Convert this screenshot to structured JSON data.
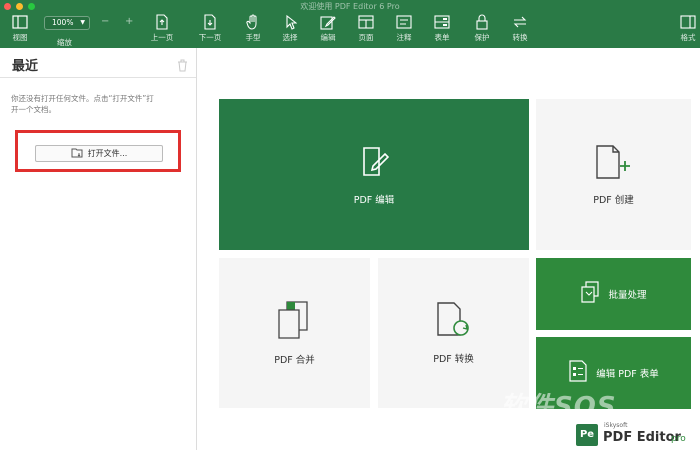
{
  "window": {
    "title": "欢迎使用 PDF Editor 6 Pro"
  },
  "toolbar": {
    "view_label": "视图",
    "zoom_value": "100%",
    "zoom_label": "缩放",
    "zoom_minus": "−",
    "zoom_plus": "+",
    "items": [
      {
        "label": "上一页",
        "icon": "prev-page-icon"
      },
      {
        "label": "下一页",
        "icon": "next-page-icon"
      },
      {
        "label": "手型",
        "icon": "hand-icon"
      },
      {
        "label": "选择",
        "icon": "select-arrow-icon"
      },
      {
        "label": "编辑",
        "icon": "edit-icon"
      },
      {
        "label": "页面",
        "icon": "page-icon"
      },
      {
        "label": "注释",
        "icon": "comment-icon"
      },
      {
        "label": "表单",
        "icon": "form-icon"
      },
      {
        "label": "保护",
        "icon": "lock-icon"
      },
      {
        "label": "转换",
        "icon": "convert-icon"
      }
    ],
    "format_label": "格式"
  },
  "sidebar": {
    "title": "最近",
    "hint": "你还没有打开任何文件。点击“打开文件”打开一个文档。",
    "open_button": "打开文件..."
  },
  "tiles": {
    "edit": "PDF 编辑",
    "create": "PDF 创建",
    "combine": "PDF 合并",
    "convert": "PDF 转换",
    "batch": "批量处理",
    "form": "编辑 PDF 表单"
  },
  "branding": {
    "watermark": "软件SOS",
    "logo": "Pe",
    "company": "iSkysoft",
    "product": "PDF Editor",
    "edition": "pro"
  },
  "colors": {
    "toolbar_green": "#2a7a46",
    "tile_green": "#277a46",
    "tile_green_light": "#2f8a3c",
    "highlight_red": "#e0302e"
  }
}
